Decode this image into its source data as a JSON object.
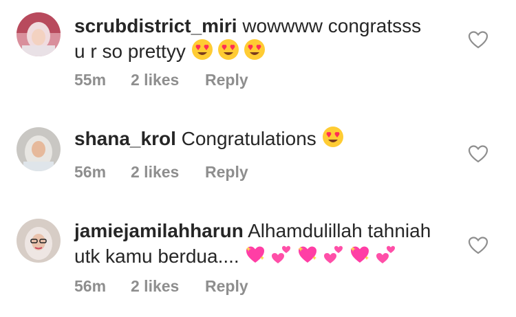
{
  "comments": [
    {
      "username": "scrubdistrict_miri",
      "text_line1": "wowwww congratsss",
      "text_line2": "u r so prettyy",
      "emojis": [
        "heart-eyes-emoji",
        "heart-eyes-emoji",
        "heart-eyes-emoji"
      ],
      "time": "55m",
      "likes": "2 likes",
      "reply": "Reply",
      "like_icon": "heart-outline-icon"
    },
    {
      "username": "shana_krol",
      "text": "Congratulations",
      "emojis": [
        "heart-eyes-emoji"
      ],
      "time": "56m",
      "likes": "2 likes",
      "reply": "Reply",
      "like_icon": "heart-outline-icon"
    },
    {
      "username": "jamiejamilahharun",
      "text_line1": "Alhamdulillah tahniah",
      "text_line2": "utk kamu berdua....",
      "emojis": [
        "sparkling-heart-emoji",
        "two-hearts-emoji",
        "sparkling-heart-emoji",
        "two-hearts-emoji",
        "sparkling-heart-emoji",
        "two-hearts-emoji"
      ],
      "time": "56m",
      "likes": "2 likes",
      "reply": "Reply",
      "like_icon": "heart-outline-icon"
    }
  ],
  "colors": {
    "text": "#262626",
    "meta": "#8e8e8e",
    "heart_outline": "#8e8e8e",
    "emoji_face": "#ffcc33",
    "emoji_heart": "#ff2d55",
    "sparkle_heart": "#ff3ea5"
  }
}
